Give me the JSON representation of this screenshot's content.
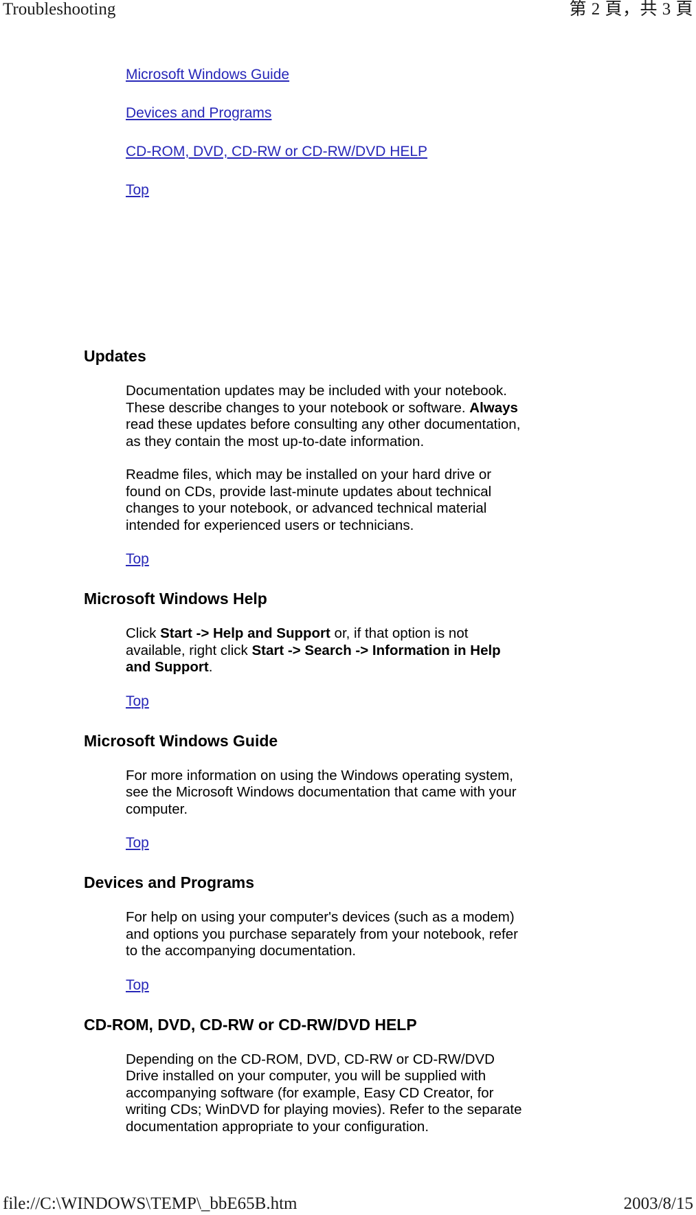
{
  "print_header": {
    "left_title": "Troubleshooting",
    "right_pagination": "第 2 頁，共 3 頁"
  },
  "print_footer": {
    "file_path": "file://C:\\WINDOWS\\TEMP\\_bbE65B.htm",
    "date": "2003/8/15"
  },
  "colors": {
    "link": "#2727b8",
    "text": "#000000",
    "background": "#ffffff"
  },
  "toc": {
    "links": [
      {
        "label": "Microsoft Windows Guide"
      },
      {
        "label": "Devices and Programs"
      },
      {
        "label": "CD-ROM, DVD, CD-RW or CD-RW/DVD HELP"
      },
      {
        "label": "Top"
      }
    ]
  },
  "sections": [
    {
      "id": "updates",
      "title": "Updates",
      "paragraphs": [
        {
          "parts": [
            {
              "text": "Documentation updates may be included with your notebook. These describe changes to your notebook or software. ",
              "bold": false
            },
            {
              "text": "Always",
              "bold": true
            },
            {
              "text": " read these updates before consulting any other documentation, as they contain the most up-to-date information.",
              "bold": false
            }
          ]
        },
        {
          "parts": [
            {
              "text": "Readme files, which may be installed on your hard drive or found on CDs, provide last-minute updates about technical changes to your notebook, or advanced technical material intended for experienced users or technicians.",
              "bold": false
            }
          ]
        }
      ],
      "top_link": "Top"
    },
    {
      "id": "microsoft-windows-help",
      "title": "Microsoft Windows Help",
      "paragraphs": [
        {
          "parts": [
            {
              "text": "Click ",
              "bold": false
            },
            {
              "text": "Start -> Help and Support",
              "bold": true
            },
            {
              "text": " or, if that option is not available, right click ",
              "bold": false
            },
            {
              "text": "Start -> Search -> Information in Help and Support",
              "bold": true
            },
            {
              "text": ".",
              "bold": false
            }
          ]
        }
      ],
      "top_link": "Top"
    },
    {
      "id": "microsoft-windows-guide",
      "title": "Microsoft Windows Guide",
      "paragraphs": [
        {
          "parts": [
            {
              "text": "For more information on using the Windows operating system, see the Microsoft Windows documentation that came with your computer.",
              "bold": false
            }
          ]
        }
      ],
      "top_link": "Top"
    },
    {
      "id": "devices-and-programs",
      "title": "Devices and Programs",
      "paragraphs": [
        {
          "parts": [
            {
              "text": "For help on using your computer's devices (such as a modem) and options you purchase separately from your notebook, refer to the accompanying documentation.",
              "bold": false
            }
          ]
        }
      ],
      "top_link": "Top"
    },
    {
      "id": "cd-rom-dvd-help",
      "title": "CD-ROM, DVD, CD-RW or CD-RW/DVD HELP",
      "paragraphs": [
        {
          "parts": [
            {
              "text": "Depending on the CD-ROM, DVD, CD-RW or CD-RW/DVD Drive installed on your computer, you will be supplied with accompanying software (for example, Easy CD Creator, for writing CDs; WinDVD for playing movies). Refer to the separate documentation appropriate to your configuration.",
              "bold": false
            }
          ]
        }
      ],
      "top_link": null
    }
  ]
}
